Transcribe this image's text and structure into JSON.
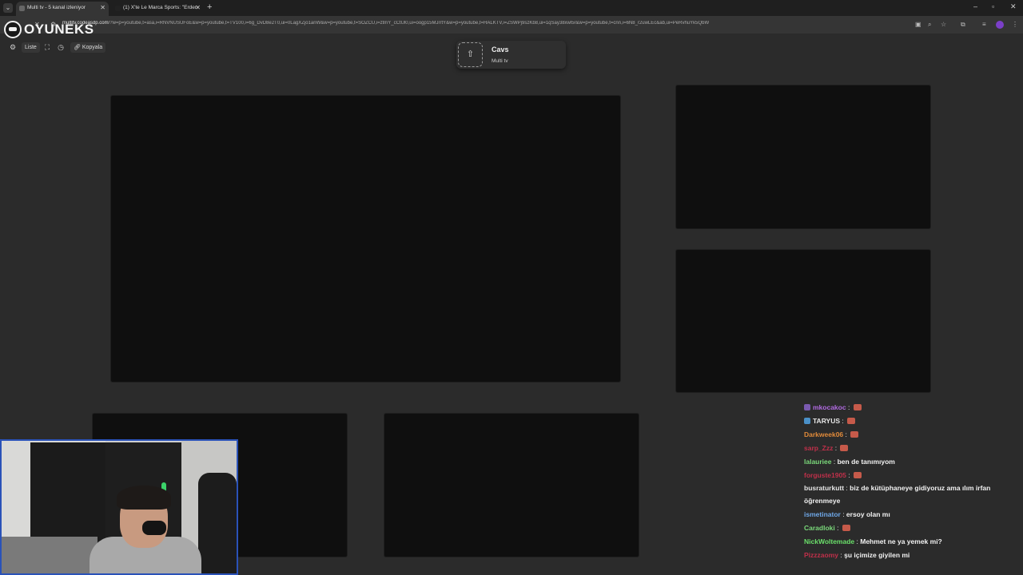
{
  "browser": {
    "tabs": [
      {
        "title": "Multi tv - 5 kanal izleniyor",
        "active": true
      },
      {
        "title": "(1) X'te Le Marca Sports: \"Erden",
        "active": false
      }
    ],
    "url_host": "multitv.codeasdp.com",
    "url_rest": "/?w=p=youtube,t=asa,i=RNVNUSUFoE&w=p=youtube,t=TV100,i=6g_DvD8e2T0,ui=0LagXZjo1anW&w=p=youtube,t=SOZCU,i=ztmY_cCtUl0,ui=oogp15MJrrtY&w=p=youtube,t=HALKTV,i=ZSWPj9szKb8,ui=1qSay38xwl5r&w=p=youtube,t=cnn,i=6N8_r2uwLEc&ab,ui=PeRvhuYk5QbW"
  },
  "logo": {
    "text": "OYUNEKS"
  },
  "toolbar": {
    "list_label": "Liste",
    "copy_label": "Kopyala"
  },
  "card": {
    "title": "Cavs",
    "subtitle": "Multi tv"
  },
  "chat": {
    "messages": [
      {
        "user": "mkocakoc",
        "color": "#b06ae0",
        "text": "",
        "emote": true,
        "badge": "#7a5ab0"
      },
      {
        "user": "TARYUS",
        "color": "#e6e6e6",
        "text": "",
        "emote": true,
        "badge": "#4a90c8"
      },
      {
        "user": "Darkweek06",
        "color": "#e08a3a",
        "text": "",
        "emote": true,
        "badge": ""
      },
      {
        "user": "sarp_Zzz",
        "color": "#c0304a",
        "text": "",
        "emote": true,
        "badge": ""
      },
      {
        "user": "lalauriee",
        "color": "#7ad87a",
        "text": "ben de tanımıyom",
        "emote": false,
        "badge": ""
      },
      {
        "user": "forguste1905",
        "color": "#c0304a",
        "text": "",
        "emote": true,
        "badge": ""
      },
      {
        "user": "busraturkutt",
        "color": "#e6e6e6",
        "text": "biz de kütüphaneye gidiyoruz ama ılım irfan öğrenmeye",
        "emote": false,
        "badge": ""
      },
      {
        "user": "ismetinator",
        "color": "#6fa8e8",
        "text": "ersoy olan mı",
        "emote": false,
        "badge": ""
      },
      {
        "user": "Caradloki",
        "color": "#7ad87a",
        "text": "",
        "emote": true,
        "badge": ""
      },
      {
        "user": "NickWoltemade",
        "color": "#6ae06a",
        "text": "Mehmet ne ya yemek mi?",
        "emote": false,
        "badge": ""
      },
      {
        "user": "Pizzzaomy",
        "color": "#c0304a",
        "text": "şu içimize giyilen mi",
        "emote": false,
        "badge": ""
      }
    ]
  }
}
